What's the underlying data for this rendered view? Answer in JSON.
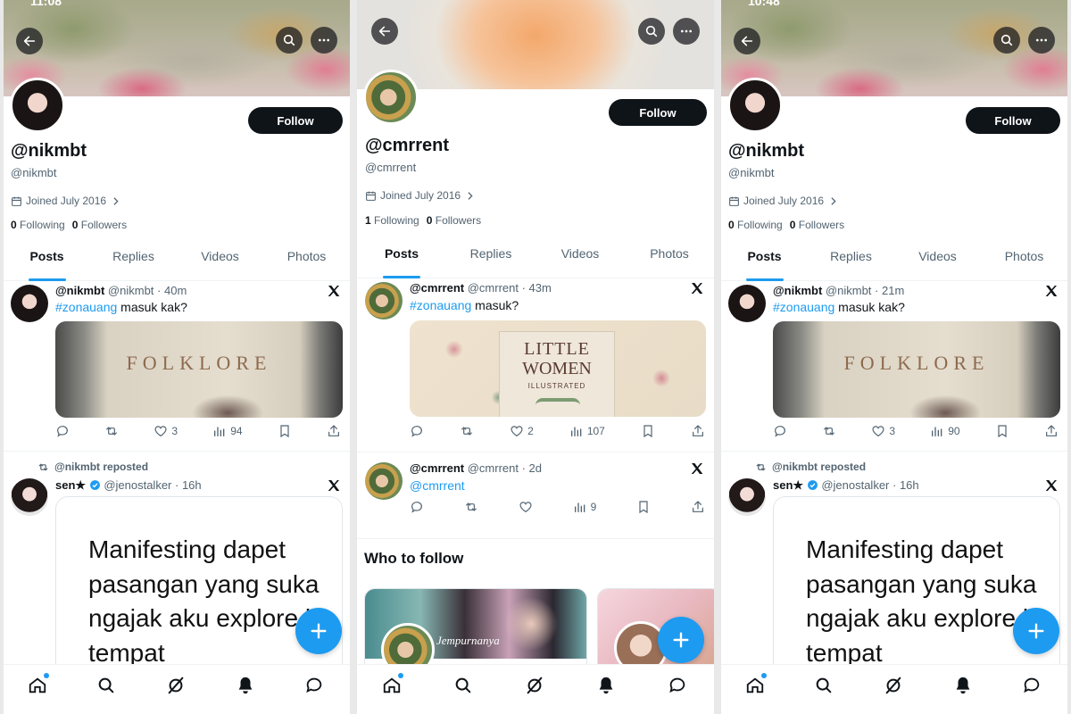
{
  "panels": [
    {
      "status_time": "11:08",
      "display_name": "@nikmbt",
      "handle": "@nikmbt",
      "joined": "Joined July 2016",
      "following_count": "0",
      "following_label": "Following",
      "followers_count": "0",
      "followers_label": "Followers",
      "follow_label": "Follow",
      "tabs": [
        "Posts",
        "Replies",
        "Videos",
        "Photos"
      ],
      "post1": {
        "name": "@nikmbt",
        "handle": "@nikmbt",
        "time": "40m",
        "hashtag": "#zonauang",
        "text": " masuk kak?",
        "media_text": "FOLKLORE",
        "likes": "3",
        "views": "94"
      },
      "repost_label": "@nikmbt reposted",
      "post2": {
        "name": "sen★",
        "handle": "@jenostalker",
        "time": "16h",
        "quote": "Manifesting dapet pasangan yang suka ngajak aku explore ke tempat"
      }
    },
    {
      "display_name": "@cmrrent",
      "handle": "@cmrrent",
      "joined": "Joined July 2016",
      "following_count": "1",
      "following_label": "Following",
      "followers_count": "0",
      "followers_label": "Followers",
      "follow_label": "Follow",
      "tabs": [
        "Posts",
        "Replies",
        "Videos",
        "Photos"
      ],
      "post1": {
        "name": "@cmrrent",
        "handle": "@cmrrent",
        "time": "43m",
        "hashtag": "#zonauang",
        "text": " masuk?",
        "book_line1": "LITTLE",
        "book_line2": "WOMEN",
        "book_line3": "ILLUSTRATED",
        "likes": "2",
        "views": "107"
      },
      "post2": {
        "name": "@cmrrent",
        "handle": "@cmrrent",
        "time": "2d",
        "mention": "@cmrrent",
        "views": "9"
      },
      "who_to_follow": "Who to follow",
      "card1_text": "Jempurnanya"
    },
    {
      "status_time": "10:48",
      "display_name": "@nikmbt",
      "handle": "@nikmbt",
      "joined": "Joined July 2016",
      "following_count": "0",
      "following_label": "Following",
      "followers_count": "0",
      "followers_label": "Followers",
      "follow_label": "Follow",
      "tabs": [
        "Posts",
        "Replies",
        "Videos",
        "Photos"
      ],
      "post1": {
        "name": "@nikmbt",
        "handle": "@nikmbt",
        "time": "21m",
        "hashtag": "#zonauang",
        "text": " masuk kak?",
        "media_text": "FOLKLORE",
        "likes": "3",
        "views": "90"
      },
      "repost_label": "@nikmbt reposted",
      "post2": {
        "name": "sen★",
        "handle": "@jenostalker",
        "time": "16h",
        "quote": "Manifesting dapet pasangan yang suka ngajak aku explore ke tempat"
      }
    }
  ],
  "icons": {
    "back": "arrow-left-icon",
    "search": "search-icon",
    "more": "more-icon",
    "calendar": "calendar-icon",
    "chevron": "chevron-right-icon",
    "x": "x-logo-icon",
    "reply": "reply-icon",
    "repost": "repost-icon",
    "like": "like-icon",
    "views": "views-icon",
    "bookmark": "bookmark-icon",
    "share": "share-icon",
    "compose": "compose-plus-icon",
    "home": "home-icon",
    "explore": "explore-icon",
    "grok": "grok-icon",
    "notifications": "bell-icon",
    "messages": "messages-icon"
  },
  "colors": {
    "accent": "#1d9bf0",
    "follow_button": "#0f1419",
    "secondary_text": "#536471"
  }
}
